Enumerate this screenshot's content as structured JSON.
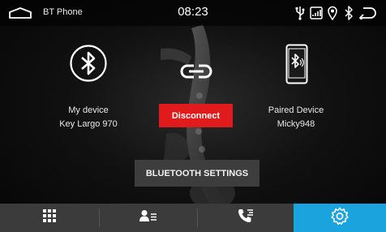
{
  "status_bar": {
    "app_title": "BT Phone",
    "time": "08:23",
    "icons": [
      "usb-icon",
      "phone-link-icon",
      "location-icon",
      "bluetooth-icon"
    ]
  },
  "my_device": {
    "label": "My device",
    "name": "Key Largo 970"
  },
  "paired_device": {
    "label": "Paired Device",
    "name": "Micky948"
  },
  "buttons": {
    "disconnect": "Disconnect",
    "bluetooth_settings": "BLUETOOTH SETTINGS"
  },
  "bottom_nav": {
    "tabs": [
      {
        "icon": "keypad-icon",
        "active": false
      },
      {
        "icon": "contacts-icon",
        "active": false
      },
      {
        "icon": "call-log-icon",
        "active": false
      },
      {
        "icon": "settings-icon",
        "active": true
      }
    ]
  },
  "colors": {
    "accent": "#1aa3dd",
    "disconnect": "#e11b1b",
    "nav_bg": "#3b3b3b"
  }
}
